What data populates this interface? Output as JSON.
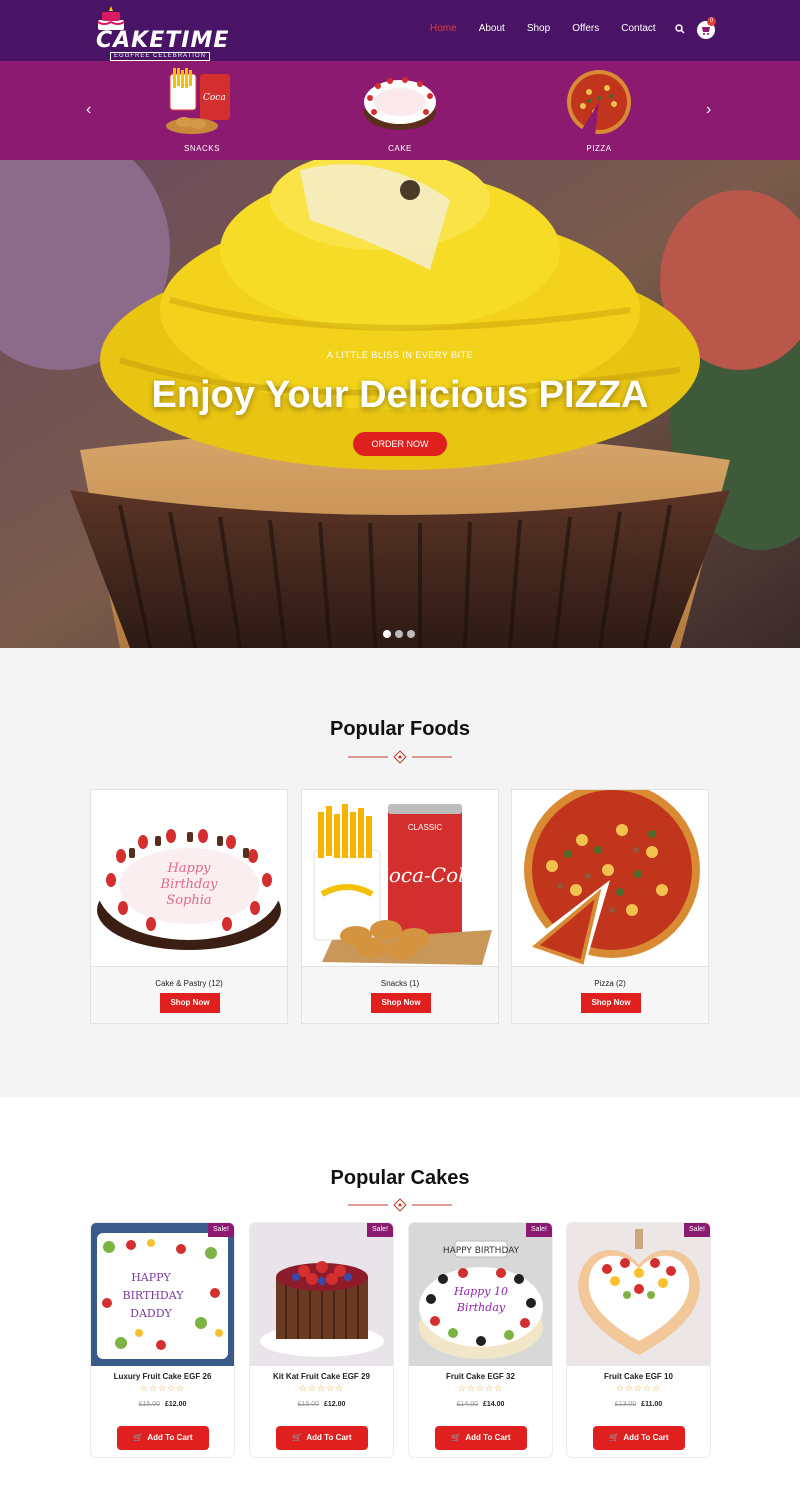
{
  "brand": {
    "name": "CAKETIME",
    "tagline": "EGGFREE CELEBRATION"
  },
  "nav": {
    "items": [
      "Home",
      "About",
      "Shop",
      "Offers",
      "Contact"
    ],
    "active": "Home",
    "cart_count": "0"
  },
  "category_carousel": {
    "items": [
      {
        "label": "SNACKS",
        "icon": "snacks-icon"
      },
      {
        "label": "CAKE",
        "icon": "cake-icon"
      },
      {
        "label": "PIZZA",
        "icon": "pizza-icon"
      }
    ],
    "prev_icon": "chevron-left-icon",
    "next_icon": "chevron-right-icon"
  },
  "hero": {
    "tagline": "A LITTLE BLISS IN EVERY BITE",
    "title": "Enjoy Your Delicious PIZZA",
    "button": "ORDER NOW",
    "slides": 3,
    "active_slide": 1
  },
  "popular_foods": {
    "title": "Popular Foods",
    "cards": [
      {
        "label": "Cake & Pastry (12)",
        "button": "Shop Now"
      },
      {
        "label": "Snacks (1)",
        "button": "Shop Now"
      },
      {
        "label": "Pizza (2)",
        "button": "Shop Now"
      }
    ]
  },
  "popular_cakes": {
    "title": "Popular Cakes",
    "cards": [
      {
        "name": "Luxury Fruit Cake EGF 26",
        "badge": "Sale!",
        "old_price": "£15.00",
        "price": "£12.00",
        "rating": 0,
        "stars": "☆☆☆☆☆",
        "button": "Add To Cart"
      },
      {
        "name": "Kit Kat Fruit Cake EGF 29",
        "badge": "Sale!",
        "old_price": "£15.00",
        "price": "£12.00",
        "rating": 0,
        "stars": "☆☆☆☆☆",
        "button": "Add To Cart"
      },
      {
        "name": "Fruit Cake EGF 32",
        "badge": "Sale!",
        "old_price": "£14.00",
        "price": "£14.00",
        "rating": 0,
        "stars": "☆☆☆☆☆",
        "button": "Add To Cart"
      },
      {
        "name": "Fruit Cake EGF 10",
        "badge": "Sale!",
        "old_price": "£13.00",
        "price": "£11.00",
        "rating": 0,
        "stars": "☆☆☆☆☆",
        "button": "Add To Cart"
      }
    ]
  },
  "colors": {
    "header": "#4a1466",
    "category_bar": "#8c1a70",
    "accent": "#e0201f",
    "sale_badge": "#8c1a70"
  }
}
